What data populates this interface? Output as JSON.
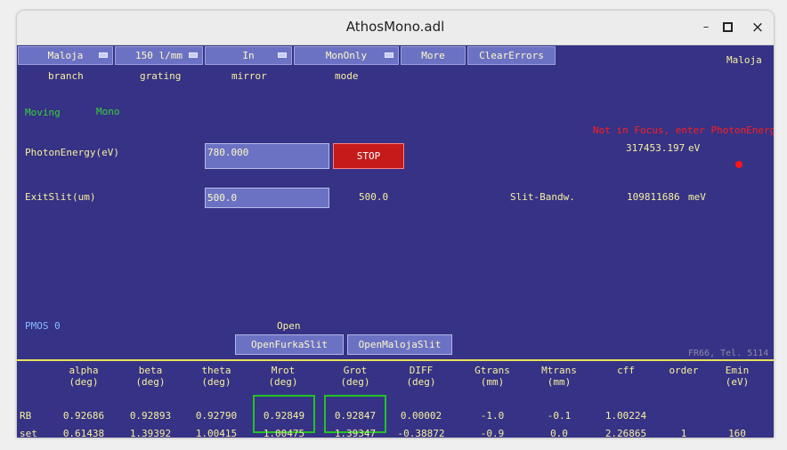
{
  "window": {
    "title": "AthosMono.adl",
    "minimize": "–",
    "maximize": "▫",
    "close": "×"
  },
  "menus": [
    {
      "label": "Maloja",
      "caption": "branch"
    },
    {
      "label": "150 l/mm",
      "caption": "grating"
    },
    {
      "label": "In",
      "caption": "mirror"
    },
    {
      "label": "MonOnly",
      "caption": "mode"
    }
  ],
  "buttons": {
    "more": "More",
    "clear_errors": "ClearErrors",
    "stop": "STOP",
    "open_furka": "OpenFurkaSlit",
    "open_maloja": "OpenMalojaSlit"
  },
  "branch_display": "Maloja",
  "status": {
    "moving": "Moving",
    "mono": "Mono",
    "focus_warning": "Not in Focus, enter PhotonEnergy"
  },
  "photon": {
    "label": "PhotonEnergy(eV)",
    "value": "780.000",
    "readback": "317453.197",
    "unit": "eV"
  },
  "exitslit": {
    "label": "ExitSlit(um)",
    "value": "500.0",
    "readback": "500.0",
    "bandw_label": "Slit-Bandw.",
    "bandw_value": "109811686",
    "bandw_unit": "meV"
  },
  "pmos": "PMOS 0",
  "open_label": "Open",
  "footer": "FR66, Tel. 5114",
  "table": {
    "columns": [
      {
        "name": "alpha",
        "unit": "(deg)"
      },
      {
        "name": "beta",
        "unit": "(deg)"
      },
      {
        "name": "theta",
        "unit": "(deg)"
      },
      {
        "name": "Mrot",
        "unit": "(deg)"
      },
      {
        "name": "Grot",
        "unit": "(deg)"
      },
      {
        "name": "DIFF",
        "unit": "(deg)"
      },
      {
        "name": "Gtrans",
        "unit": "(mm)"
      },
      {
        "name": "Mtrans",
        "unit": "(mm)"
      },
      {
        "name": "cff",
        "unit": ""
      },
      {
        "name": "order",
        "unit": ""
      },
      {
        "name": "Emin",
        "unit": "(eV)"
      }
    ],
    "rows": [
      {
        "label": "RB",
        "values": [
          "0.92686",
          "0.92893",
          "0.92790",
          "0.92849",
          "0.92847",
          "0.00002",
          "-1.0",
          "-0.1",
          "1.00224",
          "",
          ""
        ]
      },
      {
        "label": "set",
        "values": [
          "0.61438",
          "1.39392",
          "1.00415",
          "1.00475",
          "1.39347",
          "-0.38872",
          "-0.9",
          "0.0",
          "2.26865",
          "1",
          "160"
        ]
      }
    ]
  }
}
